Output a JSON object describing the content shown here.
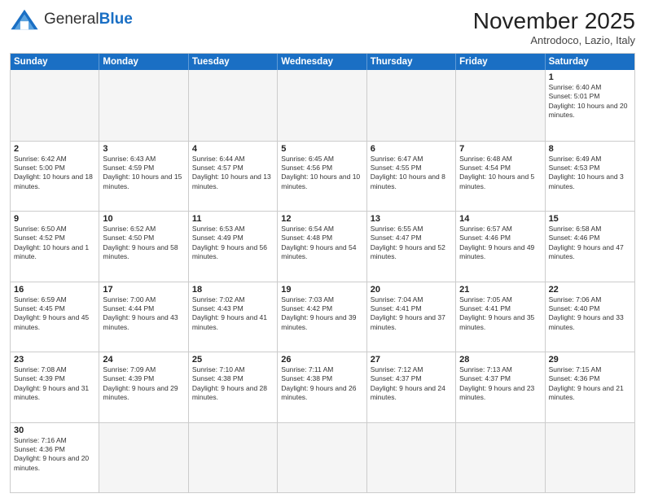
{
  "header": {
    "logo_text_general": "General",
    "logo_text_blue": "Blue",
    "month_title": "November 2025",
    "subtitle": "Antrodoco, Lazio, Italy"
  },
  "calendar": {
    "days_of_week": [
      "Sunday",
      "Monday",
      "Tuesday",
      "Wednesday",
      "Thursday",
      "Friday",
      "Saturday"
    ],
    "weeks": [
      [
        {
          "day": "",
          "info": "",
          "empty": true
        },
        {
          "day": "",
          "info": "",
          "empty": true
        },
        {
          "day": "",
          "info": "",
          "empty": true
        },
        {
          "day": "",
          "info": "",
          "empty": true
        },
        {
          "day": "",
          "info": "",
          "empty": true
        },
        {
          "day": "",
          "info": "",
          "empty": true
        },
        {
          "day": "1",
          "info": "Sunrise: 6:40 AM\nSunset: 5:01 PM\nDaylight: 10 hours and 20 minutes."
        }
      ],
      [
        {
          "day": "2",
          "info": "Sunrise: 6:42 AM\nSunset: 5:00 PM\nDaylight: 10 hours and 18 minutes."
        },
        {
          "day": "3",
          "info": "Sunrise: 6:43 AM\nSunset: 4:59 PM\nDaylight: 10 hours and 15 minutes."
        },
        {
          "day": "4",
          "info": "Sunrise: 6:44 AM\nSunset: 4:57 PM\nDaylight: 10 hours and 13 minutes."
        },
        {
          "day": "5",
          "info": "Sunrise: 6:45 AM\nSunset: 4:56 PM\nDaylight: 10 hours and 10 minutes."
        },
        {
          "day": "6",
          "info": "Sunrise: 6:47 AM\nSunset: 4:55 PM\nDaylight: 10 hours and 8 minutes."
        },
        {
          "day": "7",
          "info": "Sunrise: 6:48 AM\nSunset: 4:54 PM\nDaylight: 10 hours and 5 minutes."
        },
        {
          "day": "8",
          "info": "Sunrise: 6:49 AM\nSunset: 4:53 PM\nDaylight: 10 hours and 3 minutes."
        }
      ],
      [
        {
          "day": "9",
          "info": "Sunrise: 6:50 AM\nSunset: 4:52 PM\nDaylight: 10 hours and 1 minute."
        },
        {
          "day": "10",
          "info": "Sunrise: 6:52 AM\nSunset: 4:50 PM\nDaylight: 9 hours and 58 minutes."
        },
        {
          "day": "11",
          "info": "Sunrise: 6:53 AM\nSunset: 4:49 PM\nDaylight: 9 hours and 56 minutes."
        },
        {
          "day": "12",
          "info": "Sunrise: 6:54 AM\nSunset: 4:48 PM\nDaylight: 9 hours and 54 minutes."
        },
        {
          "day": "13",
          "info": "Sunrise: 6:55 AM\nSunset: 4:47 PM\nDaylight: 9 hours and 52 minutes."
        },
        {
          "day": "14",
          "info": "Sunrise: 6:57 AM\nSunset: 4:46 PM\nDaylight: 9 hours and 49 minutes."
        },
        {
          "day": "15",
          "info": "Sunrise: 6:58 AM\nSunset: 4:46 PM\nDaylight: 9 hours and 47 minutes."
        }
      ],
      [
        {
          "day": "16",
          "info": "Sunrise: 6:59 AM\nSunset: 4:45 PM\nDaylight: 9 hours and 45 minutes."
        },
        {
          "day": "17",
          "info": "Sunrise: 7:00 AM\nSunset: 4:44 PM\nDaylight: 9 hours and 43 minutes."
        },
        {
          "day": "18",
          "info": "Sunrise: 7:02 AM\nSunset: 4:43 PM\nDaylight: 9 hours and 41 minutes."
        },
        {
          "day": "19",
          "info": "Sunrise: 7:03 AM\nSunset: 4:42 PM\nDaylight: 9 hours and 39 minutes."
        },
        {
          "day": "20",
          "info": "Sunrise: 7:04 AM\nSunset: 4:41 PM\nDaylight: 9 hours and 37 minutes."
        },
        {
          "day": "21",
          "info": "Sunrise: 7:05 AM\nSunset: 4:41 PM\nDaylight: 9 hours and 35 minutes."
        },
        {
          "day": "22",
          "info": "Sunrise: 7:06 AM\nSunset: 4:40 PM\nDaylight: 9 hours and 33 minutes."
        }
      ],
      [
        {
          "day": "23",
          "info": "Sunrise: 7:08 AM\nSunset: 4:39 PM\nDaylight: 9 hours and 31 minutes."
        },
        {
          "day": "24",
          "info": "Sunrise: 7:09 AM\nSunset: 4:39 PM\nDaylight: 9 hours and 29 minutes."
        },
        {
          "day": "25",
          "info": "Sunrise: 7:10 AM\nSunset: 4:38 PM\nDaylight: 9 hours and 28 minutes."
        },
        {
          "day": "26",
          "info": "Sunrise: 7:11 AM\nSunset: 4:38 PM\nDaylight: 9 hours and 26 minutes."
        },
        {
          "day": "27",
          "info": "Sunrise: 7:12 AM\nSunset: 4:37 PM\nDaylight: 9 hours and 24 minutes."
        },
        {
          "day": "28",
          "info": "Sunrise: 7:13 AM\nSunset: 4:37 PM\nDaylight: 9 hours and 23 minutes."
        },
        {
          "day": "29",
          "info": "Sunrise: 7:15 AM\nSunset: 4:36 PM\nDaylight: 9 hours and 21 minutes."
        }
      ],
      [
        {
          "day": "30",
          "info": "Sunrise: 7:16 AM\nSunset: 4:36 PM\nDaylight: 9 hours and 20 minutes."
        },
        {
          "day": "",
          "info": "",
          "empty": true
        },
        {
          "day": "",
          "info": "",
          "empty": true
        },
        {
          "day": "",
          "info": "",
          "empty": true
        },
        {
          "day": "",
          "info": "",
          "empty": true
        },
        {
          "day": "",
          "info": "",
          "empty": true
        },
        {
          "day": "",
          "info": "",
          "empty": true
        }
      ]
    ]
  }
}
